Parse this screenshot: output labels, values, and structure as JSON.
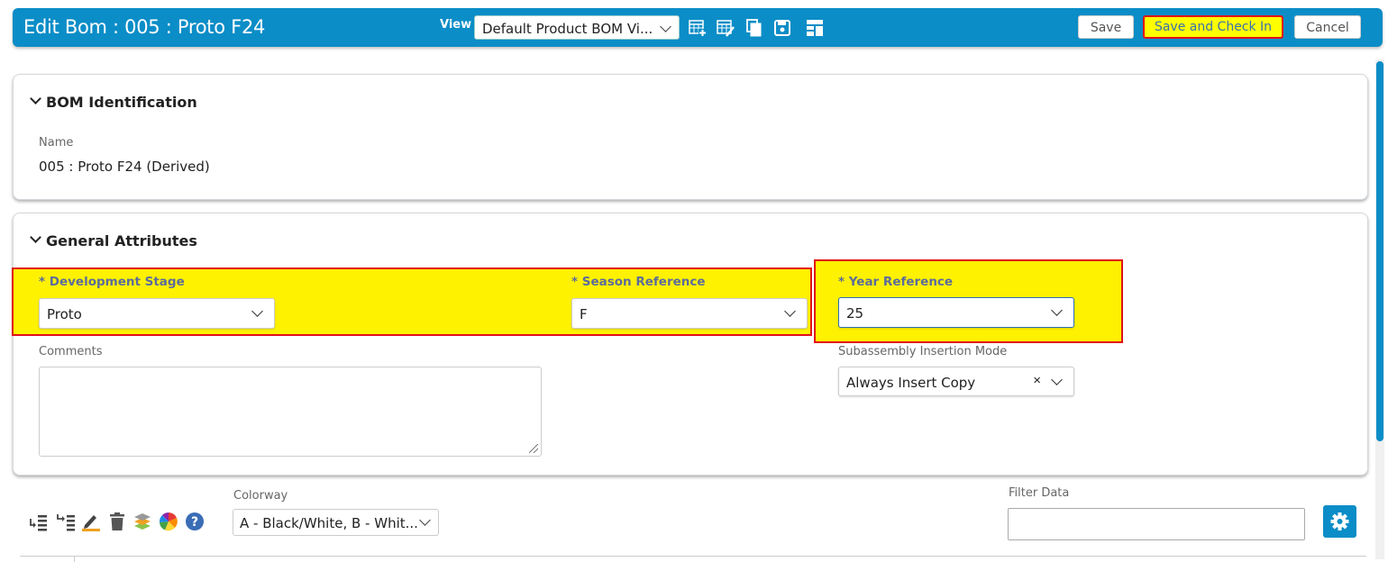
{
  "header": {
    "title": "Edit Bom : 005 : Proto F24",
    "view_label": "View",
    "view_value": "Default Product BOM Vi...",
    "icons": [
      "table-add-icon",
      "table-edit-icon",
      "copy-icon",
      "save-icon",
      "layout-icon"
    ],
    "save_label": "Save",
    "save_checkin_label": "Save and Check In",
    "cancel_label": "Cancel",
    "accent_color": "#0b8dc7"
  },
  "bom_identification": {
    "title": "BOM Identification",
    "name_label": "Name",
    "name_value": "005 : Proto F24  (Derived)"
  },
  "general_attributes": {
    "title": "General Attributes",
    "development_stage_label": "* Development Stage",
    "development_stage_value": "Proto",
    "season_reference_label": "* Season Reference",
    "season_reference_value": "F",
    "year_reference_label": "* Year Reference",
    "year_reference_value": "25",
    "comments_label": "Comments",
    "comments_value": "",
    "subassembly_label": "Subassembly Insertion Mode",
    "subassembly_value": "Always Insert Copy",
    "clear_symbol": "×"
  },
  "toolbar": {
    "icons": [
      "insert-row-icon",
      "insert-child-icon",
      "edit-highlight-icon",
      "delete-icon",
      "layers-icon",
      "color-wheel-icon",
      "help-icon"
    ],
    "colorway_label": "Colorway",
    "colorway_value": "A - Black/White, B - Whit...",
    "filter_label": "Filter Data",
    "filter_value": "",
    "settings_icon": "gear-icon"
  },
  "highlight_color": "#fff200",
  "highlight_border": "#e0101a"
}
